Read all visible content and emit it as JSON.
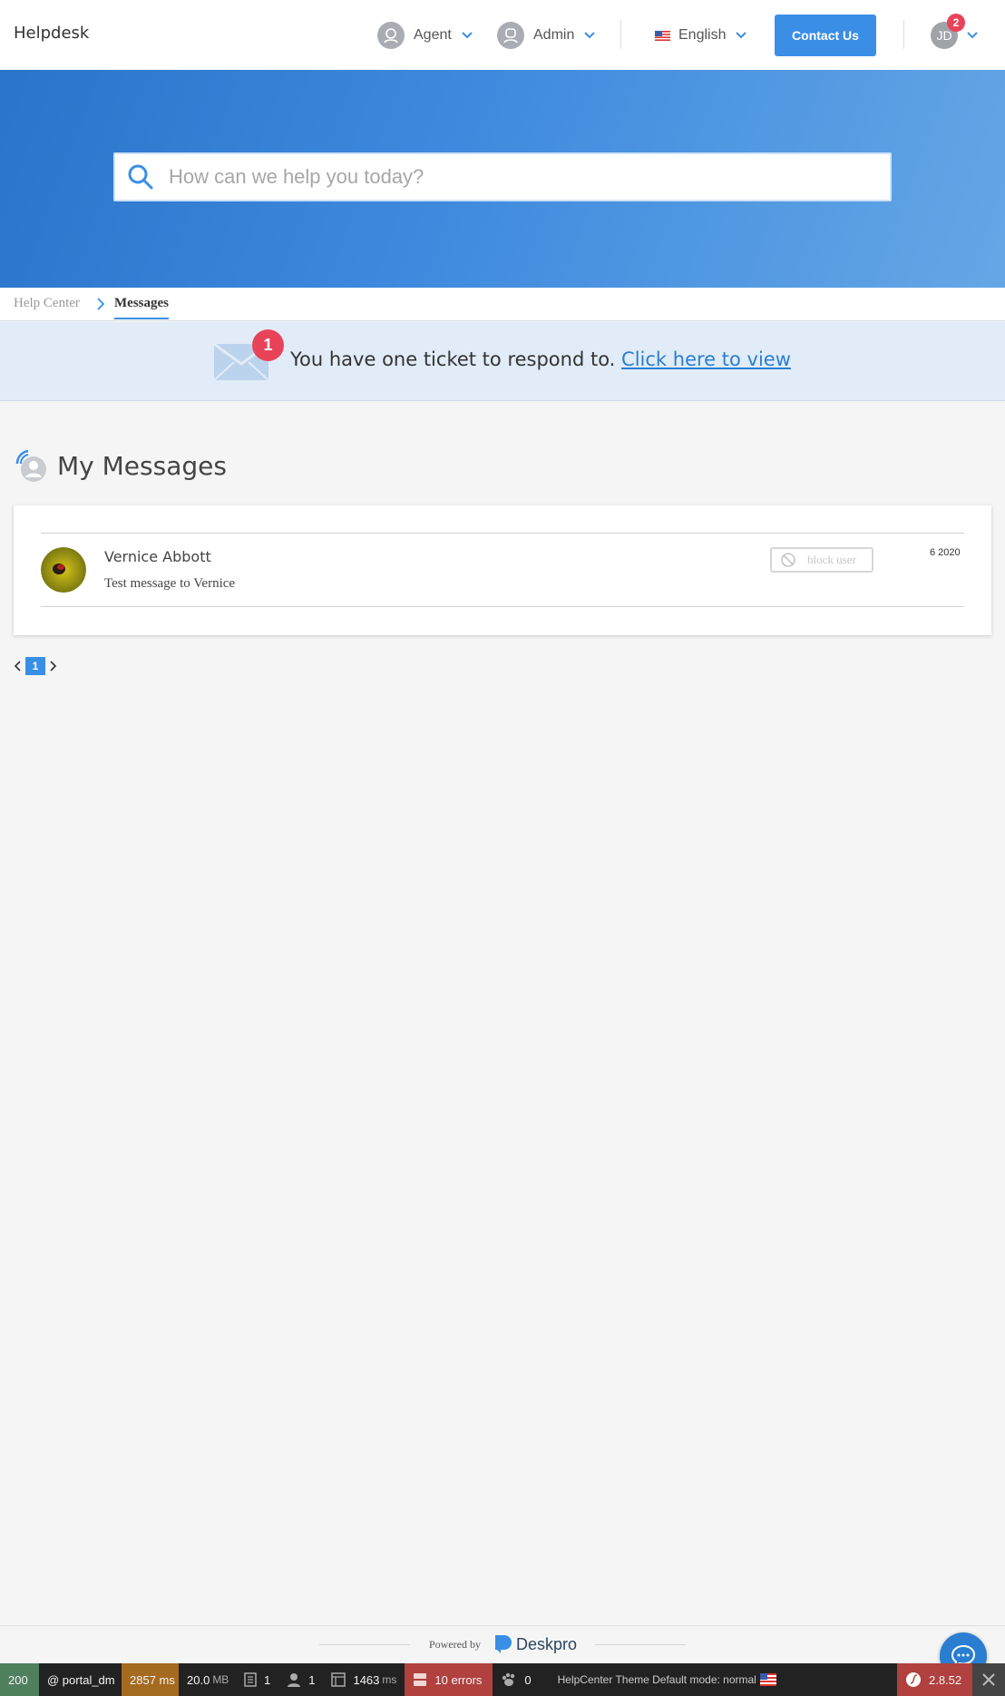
{
  "header": {
    "brand": "Helpdesk",
    "agent_label": "Agent",
    "admin_label": "Admin",
    "language_label": "English",
    "contact_label": "Contact Us",
    "user_initials": "JD",
    "user_badge_count": "2"
  },
  "search": {
    "placeholder": "How can we help you today?"
  },
  "breadcrumb": {
    "home": "Help Center",
    "current": "Messages"
  },
  "notice": {
    "badge": "1",
    "text": "You have one ticket to respond to.",
    "link": "Click here to view"
  },
  "messages": {
    "title": "My Messages",
    "items": [
      {
        "name": "Vernice Abbott",
        "preview": "Test message to Vernice",
        "block_label": "block user",
        "date": "6 2020"
      }
    ]
  },
  "pagination": {
    "current": "1"
  },
  "footer": {
    "powered_by": "Powered by",
    "brand": "Deskpro"
  },
  "toolbar": {
    "status": "200",
    "route": "@ portal_dm",
    "time": "2857 ms",
    "memory": "20.0",
    "memory_unit": "MB",
    "forms": "1",
    "user": "1",
    "db_time": "1463",
    "db_unit": "ms",
    "errors": "10 errors",
    "events": "0",
    "theme": "HelpCenter Theme Default mode: normal",
    "version": "2.8.52"
  },
  "colors": {
    "accent": "#3a8ee6",
    "badge": "#e94359",
    "hero_start": "#2a75cb",
    "hero_end": "#65a7e6"
  }
}
